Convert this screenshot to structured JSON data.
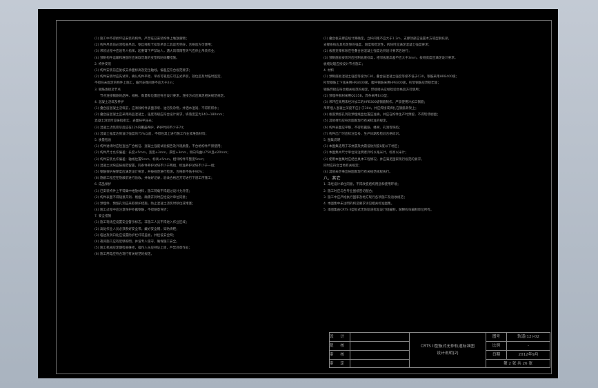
{
  "left_column": [
    {
      "text": "(1) 施工中不得损坏已安装的构件，严禁在已安装构件上堆放重物；",
      "style": "body"
    },
    {
      "text": "(2) 构件吊装前必须检查吊具、钢丝绳和卡扣等吊装工具是否完好，合格后方可使用；",
      "style": "body"
    },
    {
      "text": "(3) 吊装过程中应设专人指挥，起重臂下严禁站人，遇大风或雨雪天气应停止吊装作业；",
      "style": "body"
    },
    {
      "text": "(4) 预制构件运输和堆放时应采取可靠的支垫和防倾覆措施。",
      "style": "body"
    },
    {
      "text": "2. 构件安装",
      "style": "body"
    },
    {
      "text": "(1) 构件安装前应复核支承面标高及定位轴线，偏差应符合规范要求；",
      "style": "body"
    },
    {
      "text": "(2) 构件安装时应先试吊，确认构件平稳、吊点可靠后方可正式吊装，就位后及时临时固定，",
      "style": "body"
    },
    {
      "text": "不得在未固定的构件上施工，临时支撑间距不应大于2m；",
      "style": "body"
    },
    {
      "text": "3. 钢筋连接及节点",
      "style": "body"
    },
    {
      "text": "节点连接钢筋的品种、规格、数量和位置应符合设计要求，连接方式应满足相关规范规定。",
      "style": "indent"
    },
    {
      "text": "4. 混凝土浇筑及养护",
      "style": "body"
    },
    {
      "text": "(1) 叠合层混凝土浇筑前，应清除构件表面浮浆、油污及杂物，并洒水湿润，不得有积水；",
      "style": "body"
    },
    {
      "text": "(2) 叠合层混凝土宜采用商品混凝土，强度等级应符合设计要求，坍落度宜为140~180mm；",
      "style": "body"
    },
    {
      "text": "混凝土浇筑时应振捣密实，表面抹平压光；",
      "style": "body"
    },
    {
      "text": "(3) 混凝土浇筑完毕后应在12h内覆盖养护，养护时间不少于7d；",
      "style": "body"
    },
    {
      "text": "(4) 混凝土强度达到设计强度的75%以前，不得在其上进行施工作业或堆放材料；",
      "style": "body"
    },
    {
      "text": "5. 质量检验",
      "style": "body"
    },
    {
      "text": "(1) 构件进场时应检查出厂合格证、混凝土强度试验报告及外观质量，不合格构件严禁使用；",
      "style": "body"
    },
    {
      "text": "(2) 构件尺寸允许偏差：长度±5mm，宽度±3mm，厚度±3mm，侧向弯曲L/750且≤20mm；",
      "style": "body"
    },
    {
      "text": "(3) 构件安装允许偏差：轴线位置5mm，标高±5mm，相邻构件平整度5mm；",
      "style": "body"
    },
    {
      "text": "(4) 混凝土试块应按规范留置，同条件养护试块不少于两组，标准养护试块不少于一组；",
      "style": "body"
    },
    {
      "text": "(5) 钢筋保护层厚度应满足设计要求，并按规范进行检测，合格率不低于90%；",
      "style": "body"
    },
    {
      "text": "(6) 隐蔽工程应在隐蔽前进行验收，并做好记录，验收合格后方可进行下道工序施工；",
      "style": "body"
    },
    {
      "text": "6. 成品保护",
      "style": "body"
    },
    {
      "text": "(1) 已安装构件上不得集中堆放材料，施工荷载不得超过设计允许值；",
      "style": "body"
    },
    {
      "text": "(2) 构件表面不得随意开洞、剔凿，确需开洞时应经设计单位同意；",
      "style": "body"
    },
    {
      "text": "(3) 预埋件、预留孔洞应采取保护措施，防止混凝土浇筑时移位或堵塞；",
      "style": "body"
    },
    {
      "text": "(4) 施工过程中应注意保护外露钢筋，不得随意弯折；",
      "style": "body"
    },
    {
      "text": "7. 安全措施",
      "style": "body"
    },
    {
      "text": "(1) 施工现场应设置安全警示标志，非施工人员不得进入作业区域；",
      "style": "body"
    },
    {
      "text": "(2) 高处作业人员必须系好安全带，戴好安全帽，穿防滑鞋；",
      "style": "body"
    },
    {
      "text": "(3) 临边及洞口处应设置防护栏杆或盖板，并挂设安全网；",
      "style": "body"
    },
    {
      "text": "(4) 夜间施工应有足够照明，并设专人值守，确保施工安全。",
      "style": "body"
    },
    {
      "text": "(5) 施工机械应定期检查维修，操作人员应持证上岗，严禁违章作业；",
      "style": "body"
    },
    {
      "text": "(6) 施工用电应符合现行有关规范的规定。",
      "style": "body"
    }
  ],
  "right_column": [
    {
      "text": "(1) 叠合板支撑应经计算确定，立杆间距不宜大于1.2m，支撑顶部应设置木方或型钢托梁，",
      "style": "body"
    },
    {
      "text": "支撑系统应具有足够的强度、刚度和稳定性，拆除时应满足混凝土强度要求；",
      "style": "body"
    },
    {
      "text": "(2) 板底支撑拆除应在叠合层混凝土强度达到设计要求后进行；",
      "style": "body"
    },
    {
      "text": "(3) 预制底板安装时应控制板底标高，相邻板底高差不应大于3mm，板缝宽度应满足设计要求，",
      "style": "body"
    },
    {
      "text": "板缝处理应按设计节点施工；",
      "style": "body"
    },
    {
      "text": "4. 材料",
      "style": "body"
    },
    {
      "text": "(1) 预制底板混凝土强度等级为C30，叠合层混凝土强度等级不低于C30，钢筋采用HRB400级；",
      "style": "body"
    },
    {
      "text": "桁架钢筋上下弦采用HRB400级，腹杆钢筋采用HPB300级，桁架钢筋应焊接牢固；",
      "style": "body"
    },
    {
      "text": "钢筋焊接应符合相关规范的规定，焊接接头应经检验合格后方可使用；",
      "style": "body"
    },
    {
      "text": "(2) 预埋件钢材采用Q235B，焊条采用E43型；",
      "style": "body"
    },
    {
      "text": "(3) 吊环应采用未经冷加工的HPB300级钢筋制作，严禁使用冷加工钢筋；",
      "style": "body"
    },
    {
      "text": "吊环埋入混凝土深度不应小于30d，并应焊接或绑扎在钢筋骨架上；",
      "style": "body"
    },
    {
      "text": "(4) 板底预留孔洞及预埋线盒位置应准确，并应在构件生产时预留，不得现场剔凿；",
      "style": "body"
    },
    {
      "text": "(5) 其他材料应符合国家现行有关标准的规定。",
      "style": "body"
    },
    {
      "text": "(6) 构件表面应平整，不得有露筋、蜂窝、孔洞等缺陷；",
      "style": "body"
    },
    {
      "text": "(7) 构件出厂时应标注型号、生产日期及检验合格标识。",
      "style": "body"
    },
    {
      "text": "5. 图集说明",
      "style": "body"
    },
    {
      "text": "(1) 本图集适用于非抗震及抗震设防烈度8度以下地区；",
      "style": "body"
    },
    {
      "text": "(2) 本图集中尺寸单位除注明者外均以毫米计，标高以米计；",
      "style": "body"
    },
    {
      "text": "(3) 使用本图集时应结合具体工程情况，并应满足国家现行规范的要求，",
      "style": "body"
    },
    {
      "text": "同时应符合当地有关规定；",
      "style": "body"
    },
    {
      "text": "(4) 其他未尽事宜按国家现行有关规范规程执行。",
      "style": "body"
    },
    {
      "text": "八、其它",
      "style": "heading"
    },
    {
      "text": "1. 未经设计单位同意，不得改变结构用途和使用环境；",
      "style": "body"
    },
    {
      "text": "2. 施工时应与各专业图纸密切配合；",
      "style": "body"
    },
    {
      "text": "3. 施工中应严格执行国家及地方现行各项施工及验收规范；",
      "style": "body"
    },
    {
      "text": "4. 本图集中未注明的构造要求详见相关标准图集。",
      "style": "body"
    },
    {
      "text": "5. 本图集由CRTS II型板式无砟轨道标准设计组编制，解释权归编制单位所有。",
      "style": "body"
    }
  ],
  "title_block": {
    "labels": [
      "设 计 者",
      "复 核 者",
      "审 核 者",
      "审 定 者"
    ],
    "title_lines": [
      "CRTS II型板式无砟轨道标准图",
      "设计说明(2)"
    ],
    "drawing_no_label": "图号",
    "drawing_no": "轨道(12)-02",
    "scale_label": "比例",
    "scale": "-",
    "date_label": "日期",
    "date": "2012年9月",
    "sheet_text": "第 2 张 共 26 张"
  },
  "colors": {
    "background": "#b3bcc8",
    "sheet": "#000000",
    "text": "#9a9a9a",
    "frame": "#6e6e6e"
  }
}
